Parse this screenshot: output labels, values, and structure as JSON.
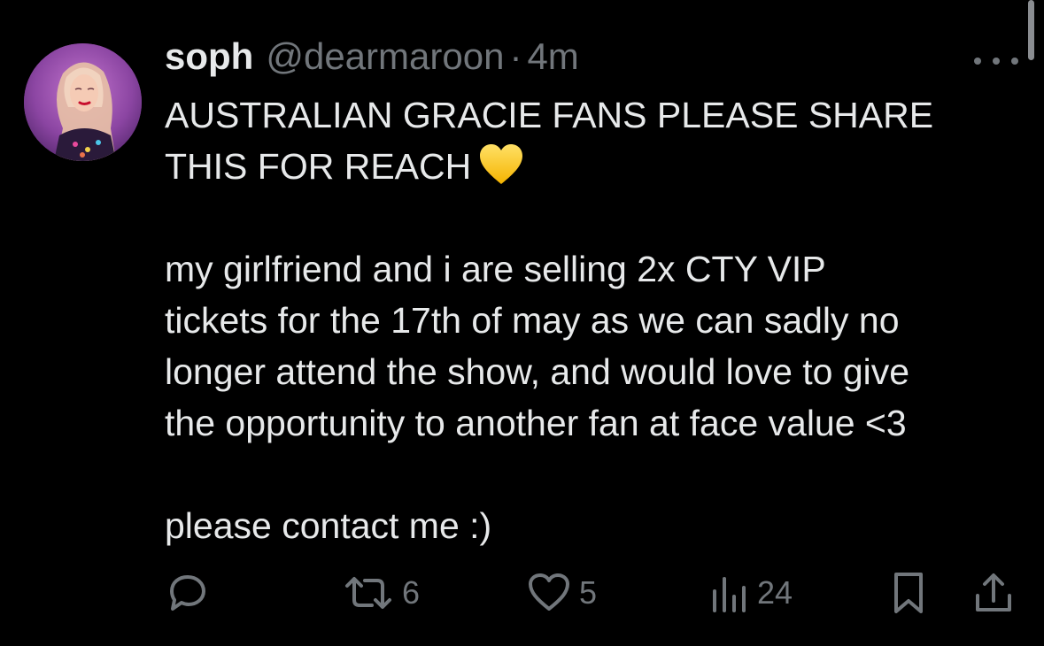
{
  "post": {
    "author": {
      "display_name": "soph",
      "handle": "@dearmaroon",
      "separator": "·",
      "time": "4m",
      "avatar_icon": "profile-photo"
    },
    "more_icon": "ellipsis-icon",
    "lines": [
      "AUSTRALIAN GRACIE FANS PLEASE SHARE",
      "THIS FOR REACH",
      "",
      "my girlfriend and i are selling 2x CTY VIP",
      "tickets for the 17th of may as we can sadly no",
      "longer attend the show, and would love to give",
      "the opportunity to another fan at face value <3",
      "",
      "please contact me :)"
    ],
    "emoji": "yellow-heart"
  },
  "actions": {
    "reply": {
      "icon": "reply-icon",
      "count": ""
    },
    "repost": {
      "icon": "repost-icon",
      "count": "6"
    },
    "like": {
      "icon": "heart-icon",
      "count": "5"
    },
    "views": {
      "icon": "views-icon",
      "count": "24"
    },
    "bookmark": {
      "icon": "bookmark-icon"
    },
    "share": {
      "icon": "share-icon"
    }
  },
  "colors": {
    "background": "#000000",
    "text_primary": "#e7e9ea",
    "text_secondary": "#71767b",
    "emoji_yellow": "#ffcc33"
  }
}
